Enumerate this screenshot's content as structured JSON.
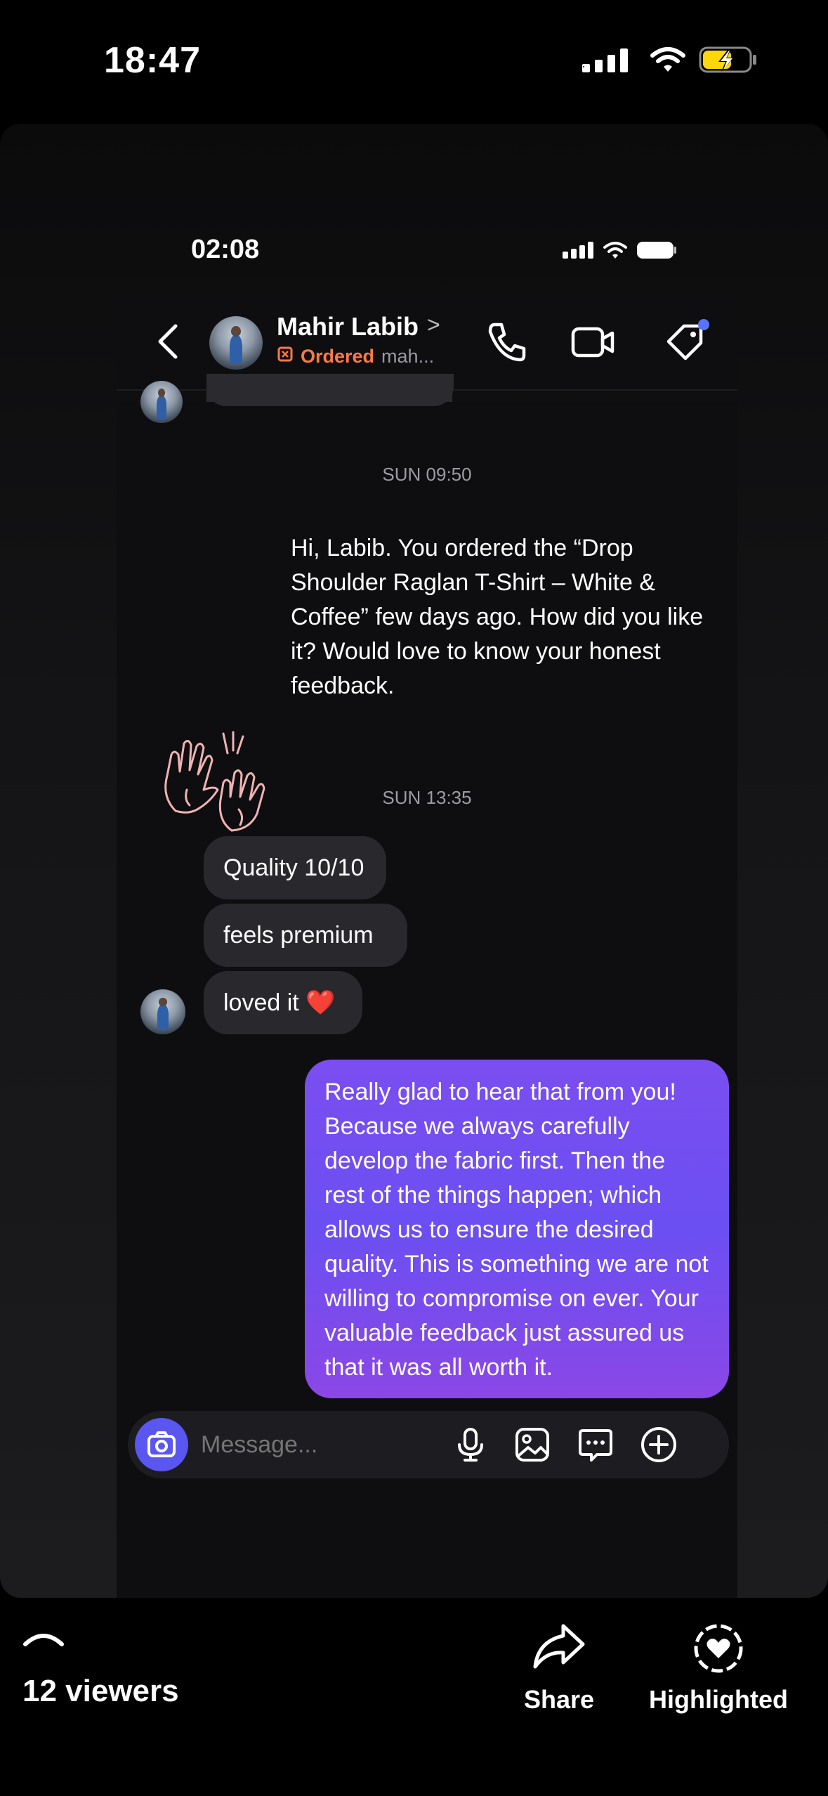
{
  "os_status": {
    "time": "18:47"
  },
  "inner_status": {
    "time": "02:08"
  },
  "chat_header": {
    "contact_name": "Mahir Labib",
    "name_chevron": ">",
    "ordered_label": "Ordered",
    "sub_text": "mah..."
  },
  "messages": {
    "timestamp_1": "SUN 09:50",
    "outgoing_1": "Hi, Labib. You ordered the “Drop Shoulder Raglan T-Shirt – White & Coffee” few days ago. How did you like it? Would love to know your honest feedback.",
    "timestamp_2": "SUN 13:35",
    "incoming_1": "Quality 10/10",
    "incoming_2": "feels premium",
    "incoming_3": "loved it ❤️",
    "outgoing_2": "Really glad to hear that from you! Because we always carefully develop the fabric first. Then the rest of the things happen; which allows us to ensure the desired quality. This is something we are not willing to compromise on ever. Your valuable feedback just assured us that it was all worth it."
  },
  "composer": {
    "placeholder": "Message..."
  },
  "bottom_bar": {
    "viewers": "12 viewers",
    "share_label": "Share",
    "highlighted_label": "Highlighted"
  },
  "colors": {
    "accent_blue": "#5a56f0",
    "accent_purple": "#7a4df0",
    "ordered_orange": "#ff7a45",
    "battery_yellow": "#ffd60a"
  }
}
